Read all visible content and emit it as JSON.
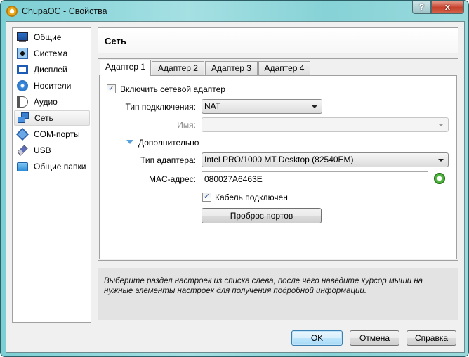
{
  "window": {
    "title": "ChupaOC - Свойства",
    "help_label": "?",
    "close_label": "x"
  },
  "sidebar": {
    "items": [
      {
        "label": "Общие",
        "icon": "monitor-general-icon"
      },
      {
        "label": "Система",
        "icon": "chip-icon"
      },
      {
        "label": "Дисплей",
        "icon": "display-icon"
      },
      {
        "label": "Носители",
        "icon": "disk-icon"
      },
      {
        "label": "Аудио",
        "icon": "speaker-icon"
      },
      {
        "label": "Сеть",
        "icon": "network-icon",
        "selected": true
      },
      {
        "label": "COM-порты",
        "icon": "serial-port-icon"
      },
      {
        "label": "USB",
        "icon": "usb-icon"
      },
      {
        "label": "Общие папки",
        "icon": "folder-icon"
      }
    ]
  },
  "header": {
    "title": "Сеть"
  },
  "tabs": [
    {
      "label": "Адаптер 1",
      "active": true
    },
    {
      "label": "Адаптер 2"
    },
    {
      "label": "Адаптер 3"
    },
    {
      "label": "Адаптер 4"
    }
  ],
  "form": {
    "enable_adapter": {
      "label": "Включить сетевой адаптер",
      "checked": true,
      "mark": "✓"
    },
    "attached_to": {
      "label": "Тип подключения:",
      "value": "NAT"
    },
    "name": {
      "label": "Имя:",
      "value": ""
    },
    "advanced": {
      "label": "Дополнительно"
    },
    "adapter_type": {
      "label": "Тип адаптера:",
      "value": "Intel PRO/1000 MT Desktop (82540EM)"
    },
    "mac": {
      "label": "MAC-адрес:",
      "value": "080027A6463E"
    },
    "cable": {
      "label": "Кабель подключен",
      "checked": true,
      "mark": "✓"
    },
    "port_forwarding": {
      "label": "Проброс портов"
    }
  },
  "info": {
    "text": "Выберите раздел настроек из списка слева, после чего наведите курсор мыши на нужные элементы настроек для получения подробной информации."
  },
  "buttons": {
    "ok": "OK",
    "cancel": "Отмена",
    "help": "Справка"
  },
  "colors": {
    "frame": "#8fd5d9",
    "accent": "#3c7fb1",
    "refresh": "#3a9e2a"
  }
}
